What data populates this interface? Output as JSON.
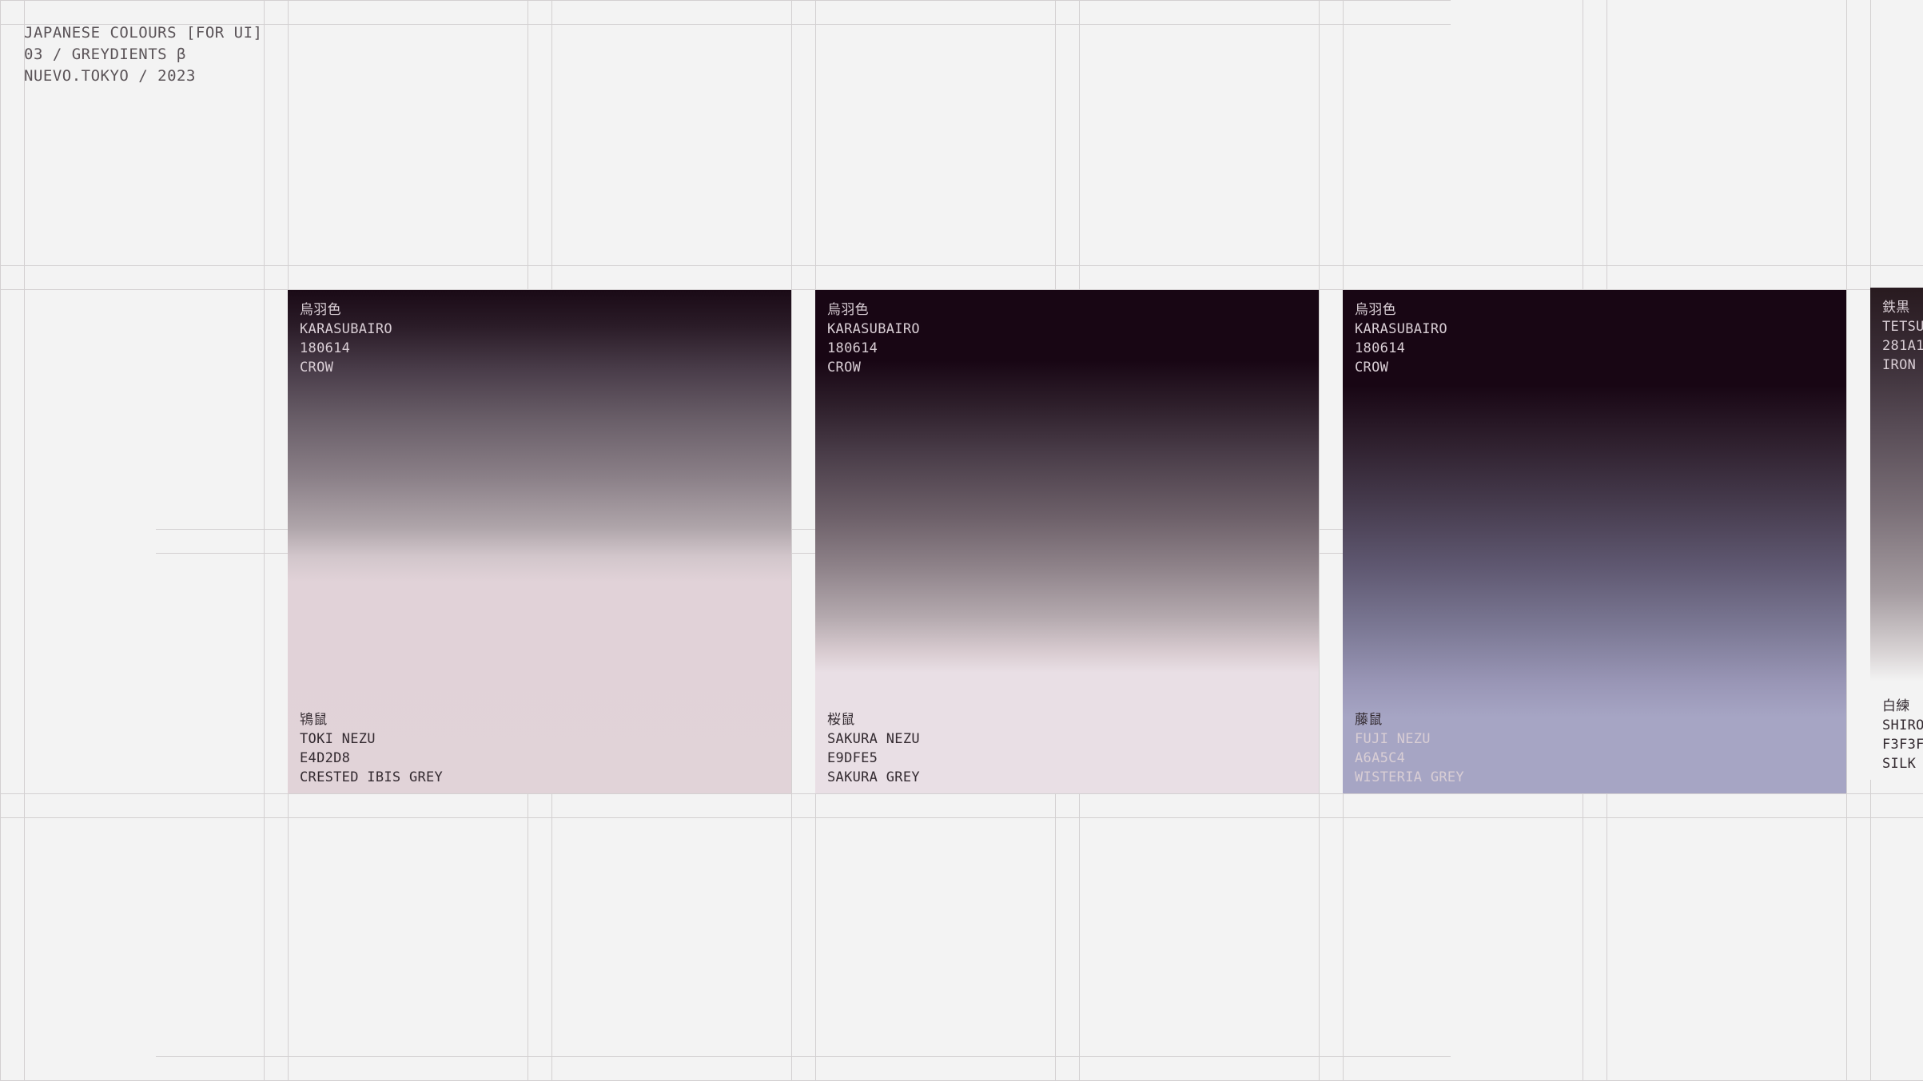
{
  "header": {
    "line1": "JAPANESE COLOURS [FOR UI]",
    "line2": "03 / GREYDIENTS β",
    "line3": "NUEVO.TOKYO / 2023"
  },
  "swatches": [
    {
      "top": {
        "kanji": "烏羽色",
        "name": "KARASUBAIRO",
        "hex": "180614",
        "english": "CROW"
      },
      "bottom": {
        "kanji": "鴇鼠",
        "name": "TOKI NEZU",
        "hex": "E4D2D8",
        "english": "CRESTED IBIS GREY"
      },
      "colors": {
        "from": "#180614",
        "to": "#E4D2D8"
      }
    },
    {
      "top": {
        "kanji": "烏羽色",
        "name": "KARASUBAIRO",
        "hex": "180614",
        "english": "CROW"
      },
      "bottom": {
        "kanji": "桜鼠",
        "name": "SAKURA NEZU",
        "hex": "E9DFE5",
        "english": "SAKURA GREY"
      },
      "colors": {
        "from": "#180614",
        "to": "#E9DFE5"
      }
    },
    {
      "top": {
        "kanji": "烏羽色",
        "name": "KARASUBAIRO",
        "hex": "180614",
        "english": "CROW"
      },
      "bottom": {
        "kanji": "藤鼠",
        "name": "FUJI NEZU",
        "hex": "A6A5C4",
        "english": "WISTERIA GREY"
      },
      "colors": {
        "from": "#180614",
        "to": "#A6A5C4"
      }
    },
    {
      "top": {
        "kanji": "鉄黒",
        "name": "TETSU",
        "hex": "281A1",
        "english": "IRON"
      },
      "bottom": {
        "kanji": "白練",
        "name": "SHIRO",
        "hex": "F3F3F",
        "english": "SILK"
      },
      "colors": {
        "from": "#281A1F",
        "to": "#F3F3F3"
      }
    }
  ]
}
